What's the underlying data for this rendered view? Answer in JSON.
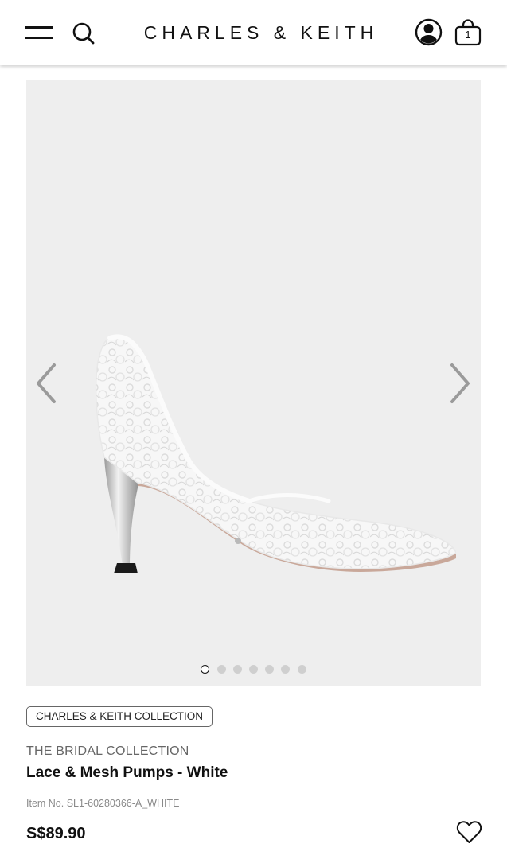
{
  "header": {
    "brand": "CHARLES & KEITH",
    "cart_count": "1",
    "icons": [
      "menu-icon",
      "search-icon",
      "account-icon",
      "shopping-bag-icon"
    ]
  },
  "gallery": {
    "image_count": 7,
    "active_index": 0,
    "icons": [
      "chevron-left-icon",
      "chevron-right-icon"
    ],
    "background": "#eeeeee"
  },
  "product": {
    "badge": "CHARLES & KEITH COLLECTION",
    "collection": "THE BRIDAL COLLECTION",
    "name": "Lace & Mesh Pumps - White",
    "item_no": "Item No. SL1-60280366-A_WHITE",
    "price": "S$89.90",
    "wishlist_icon": "heart-outline-icon"
  }
}
